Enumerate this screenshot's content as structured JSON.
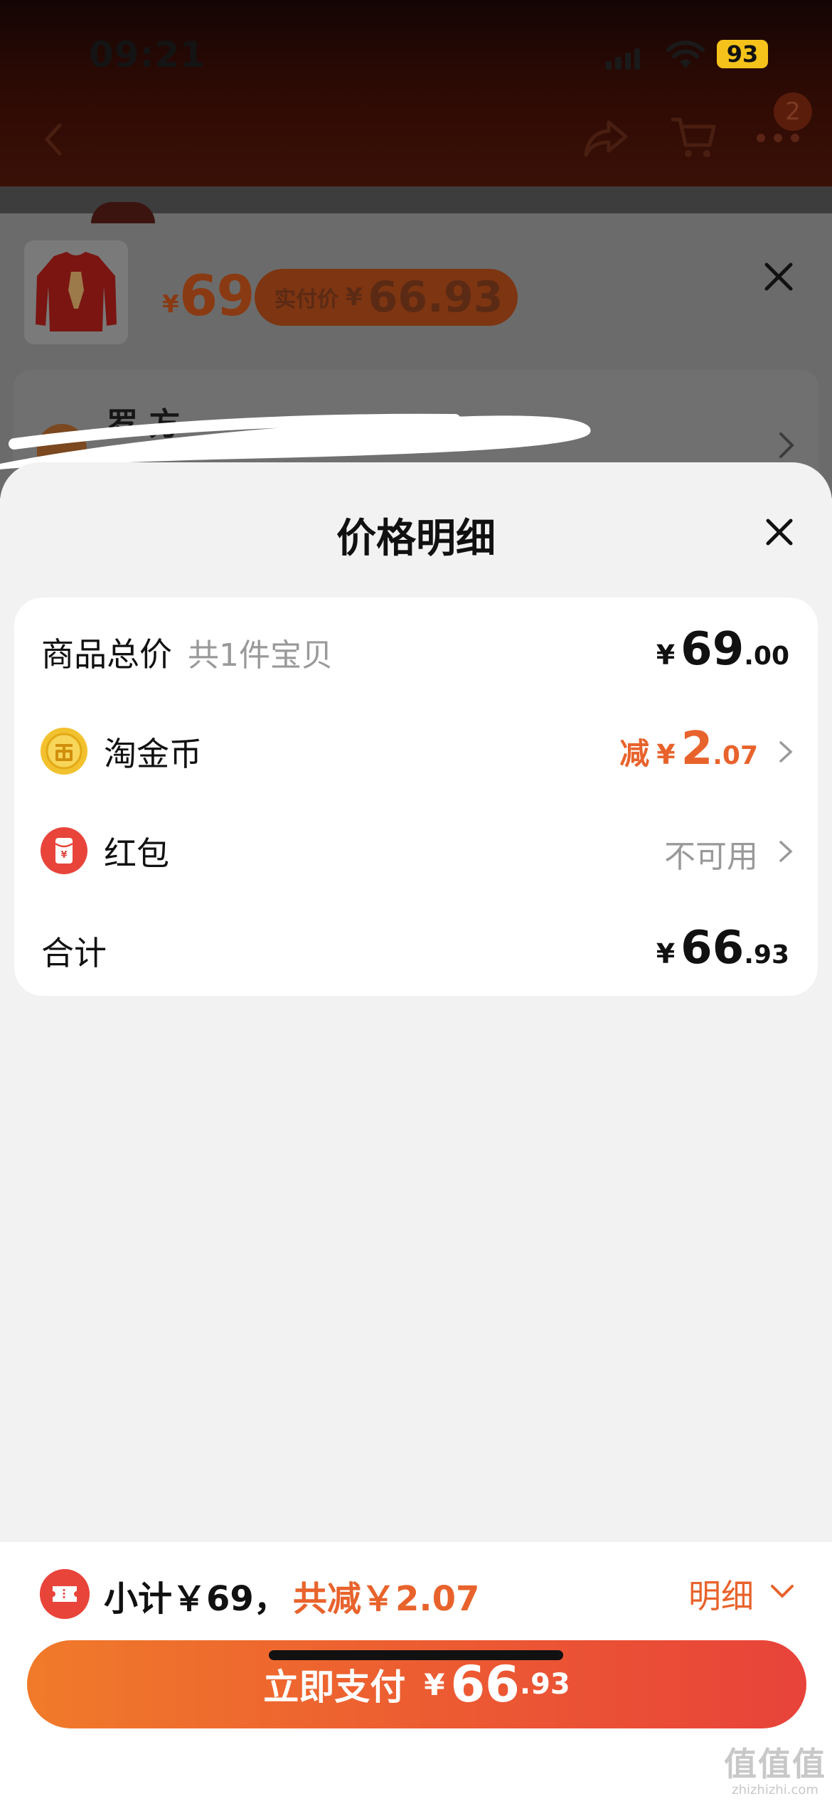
{
  "status_bar": {
    "time": "09:21",
    "battery": "93"
  },
  "nav": {
    "badge_count": "2"
  },
  "sku": {
    "currency": "¥",
    "price": "69",
    "realpay_label": "实付价",
    "realpay_currency": "¥",
    "realpay_value": "66.93",
    "address_text": "罗 方"
  },
  "price_detail": {
    "title": "价格明细",
    "rows": [
      {
        "label": "商品总价",
        "sub": "共1件宝贝",
        "currency": "¥",
        "int": "69",
        "dec": ".00"
      },
      {
        "label": "淘金币",
        "discount_label": "减",
        "currency": "¥",
        "int": "2",
        "dec": ".07",
        "icon": "coin-icon"
      },
      {
        "label": "红包",
        "status": "不可用",
        "icon": "red-packet-icon"
      },
      {
        "label": "合计",
        "currency": "¥",
        "int": "66",
        "dec": ".93"
      }
    ]
  },
  "bottom_bar": {
    "subtotal": "小计￥69，",
    "saved": "共减￥2.07",
    "detail_toggle": "明细",
    "pay_label": "立即支付",
    "pay_currency": "¥",
    "pay_int": "66",
    "pay_dec": ".93"
  },
  "watermark": {
    "logo": "值值值",
    "url": "zhizhizhi.com"
  },
  "colors": {
    "accent": "#e8632c",
    "pay_gradient_start": "#f07a2a",
    "pay_gradient_end": "#e8433a",
    "coupon_red": "#e8443a",
    "coin_gold": "#f2c12e"
  }
}
